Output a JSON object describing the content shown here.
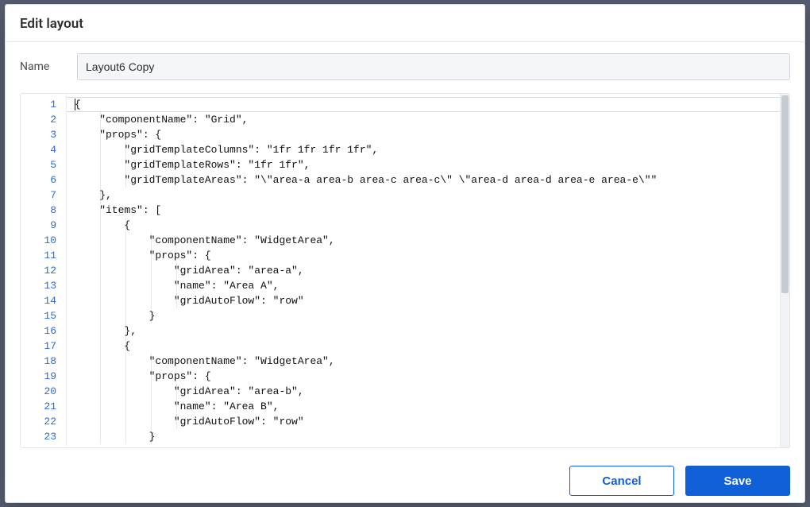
{
  "dialog": {
    "title": "Edit layout",
    "name_field": {
      "label": "Name",
      "value": "Layout6 Copy"
    },
    "buttons": {
      "cancel": "Cancel",
      "save": "Save"
    }
  },
  "editor": {
    "line_numbers_start": 1,
    "line_count": 23,
    "indent_size": 4,
    "lines": [
      {
        "indent": 0,
        "text": "{"
      },
      {
        "indent": 1,
        "text": "\"componentName\": \"Grid\","
      },
      {
        "indent": 1,
        "text": "\"props\": {"
      },
      {
        "indent": 2,
        "text": "\"gridTemplateColumns\": \"1fr 1fr 1fr 1fr\","
      },
      {
        "indent": 2,
        "text": "\"gridTemplateRows\": \"1fr 1fr\","
      },
      {
        "indent": 2,
        "text": "\"gridTemplateAreas\": \"\\\"area-a area-b area-c area-c\\\" \\\"area-d area-d area-e area-e\\\"\""
      },
      {
        "indent": 1,
        "text": "},"
      },
      {
        "indent": 1,
        "text": "\"items\": ["
      },
      {
        "indent": 2,
        "text": "{"
      },
      {
        "indent": 3,
        "text": "\"componentName\": \"WidgetArea\","
      },
      {
        "indent": 3,
        "text": "\"props\": {"
      },
      {
        "indent": 4,
        "text": "\"gridArea\": \"area-a\","
      },
      {
        "indent": 4,
        "text": "\"name\": \"Area A\","
      },
      {
        "indent": 4,
        "text": "\"gridAutoFlow\": \"row\""
      },
      {
        "indent": 3,
        "text": "}"
      },
      {
        "indent": 2,
        "text": "},"
      },
      {
        "indent": 2,
        "text": "{"
      },
      {
        "indent": 3,
        "text": "\"componentName\": \"WidgetArea\","
      },
      {
        "indent": 3,
        "text": "\"props\": {"
      },
      {
        "indent": 4,
        "text": "\"gridArea\": \"area-b\","
      },
      {
        "indent": 4,
        "text": "\"name\": \"Area B\","
      },
      {
        "indent": 4,
        "text": "\"gridAutoFlow\": \"row\""
      },
      {
        "indent": 3,
        "text": "}"
      }
    ]
  }
}
